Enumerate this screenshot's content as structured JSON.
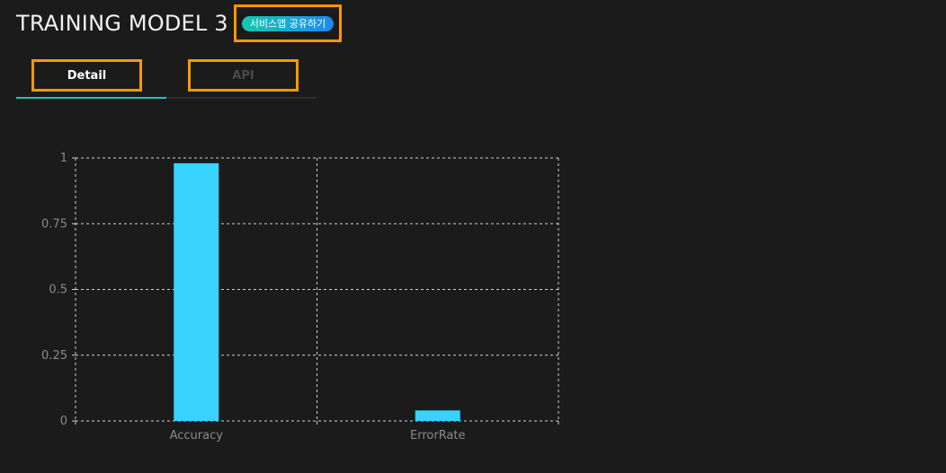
{
  "header": {
    "title": "TRAINING MODEL 3",
    "share_label": "서비스앱 공유하기"
  },
  "tabs": [
    {
      "label": "Detail",
      "active": true
    },
    {
      "label": "API",
      "active": false
    }
  ],
  "colors": {
    "background": "#1b1b1b",
    "bar": "#38d3ff",
    "tab_active_underline": "#1fc3b5",
    "highlight_border": "#ff9800"
  },
  "chart_data": {
    "type": "bar",
    "categories": [
      "Accuracy",
      "ErrorRate"
    ],
    "values": [
      0.98,
      0.04
    ],
    "ylim": [
      0,
      1
    ],
    "yticks": [
      {
        "value": 0,
        "label": "0"
      },
      {
        "value": 0.25,
        "label": "0.25"
      },
      {
        "value": 0.5,
        "label": "0.5"
      },
      {
        "value": 0.75,
        "label": "0.75"
      },
      {
        "value": 1,
        "label": "1"
      }
    ],
    "grid": true,
    "legend": "none"
  }
}
